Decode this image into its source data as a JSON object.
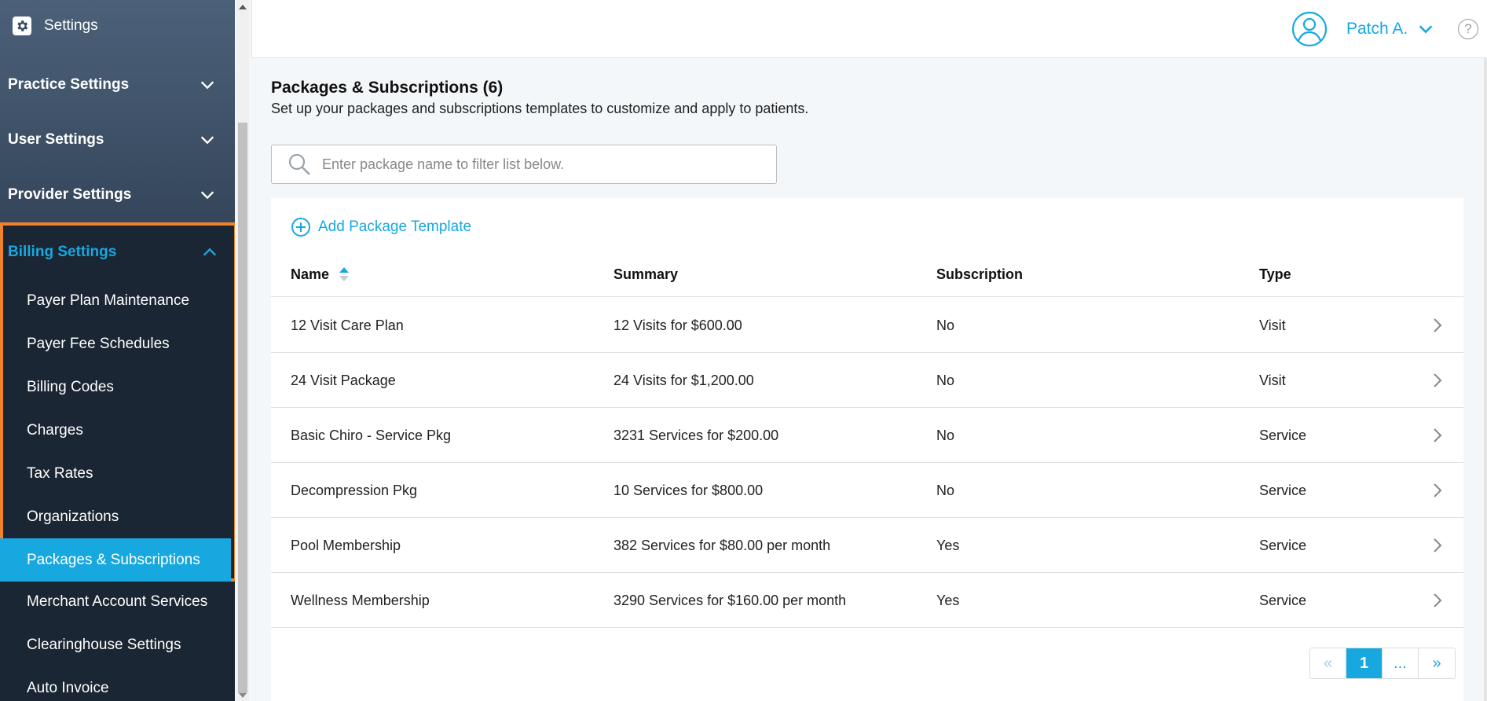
{
  "sidebar": {
    "title": "Settings",
    "sections": [
      {
        "label": "Practice Settings"
      },
      {
        "label": "User Settings"
      },
      {
        "label": "Provider Settings"
      }
    ],
    "billing": {
      "label": "Billing Settings",
      "items": [
        {
          "label": "Payer Plan Maintenance"
        },
        {
          "label": "Payer Fee Schedules"
        },
        {
          "label": "Billing Codes"
        },
        {
          "label": "Charges"
        },
        {
          "label": "Tax Rates"
        },
        {
          "label": "Organizations"
        },
        {
          "label": "Packages & Subscriptions"
        }
      ],
      "active_item": "Packages & Subscriptions"
    },
    "after_items": [
      {
        "label": "Merchant Account Services"
      },
      {
        "label": "Clearinghouse Settings"
      },
      {
        "label": "Auto Invoice"
      }
    ]
  },
  "header": {
    "user_name": "Patch A.",
    "help_glyph": "?"
  },
  "main": {
    "title": "Packages & Subscriptions (6)",
    "subtitle": "Set up your packages and subscriptions templates to customize and apply to patients.",
    "search_placeholder": "Enter package name to filter list below.",
    "add_label": "Add Package Template",
    "columns": {
      "name": "Name",
      "summary": "Summary",
      "subscription": "Subscription",
      "type": "Type"
    },
    "rows": [
      {
        "name": "12 Visit Care Plan",
        "summary": "12 Visits for $600.00",
        "subscription": "No",
        "type": "Visit"
      },
      {
        "name": "24 Visit Package",
        "summary": "24 Visits for $1,200.00",
        "subscription": "No",
        "type": "Visit"
      },
      {
        "name": "Basic Chiro - Service Pkg",
        "summary": "3231 Services for $200.00",
        "subscription": "No",
        "type": "Service"
      },
      {
        "name": "Decompression Pkg",
        "summary": "10 Services for $800.00",
        "subscription": "No",
        "type": "Service"
      },
      {
        "name": "Pool Membership",
        "summary": "382 Services for $80.00 per month",
        "subscription": "Yes",
        "type": "Service"
      },
      {
        "name": "Wellness Membership",
        "summary": "3290 Services for $160.00 per month",
        "subscription": "Yes",
        "type": "Service"
      }
    ],
    "pagination": {
      "prev": "«",
      "current": "1",
      "ellipsis": "...",
      "next": "»"
    }
  },
  "colors": {
    "accent": "#17a8e0",
    "highlight_border": "#f0832a",
    "sidebar_bg": "#1b2634"
  },
  "icons": {
    "settings": "gear-icon",
    "section_toggle": "chevron-down-icon",
    "billing_toggle": "chevron-up-icon",
    "avatar": "user-avatar-icon",
    "user_menu": "chevron-down-icon",
    "help": "help-icon",
    "search": "search-icon",
    "add": "plus-circle-icon",
    "sort": "sort-icon",
    "row_open": "chevron-right-icon"
  }
}
